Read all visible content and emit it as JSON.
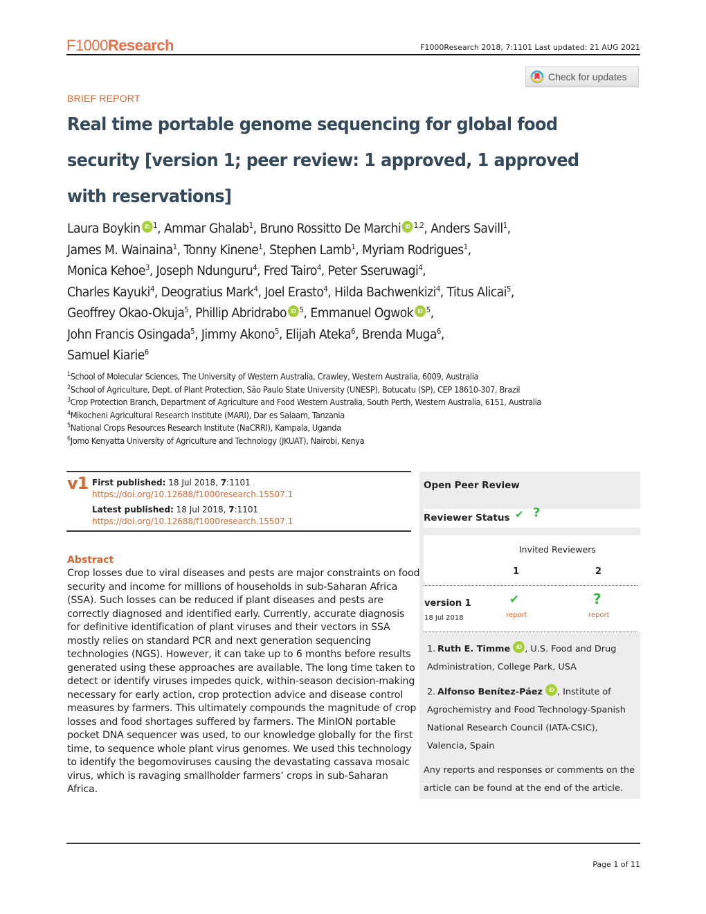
{
  "header": {
    "logo_prefix": "F1000",
    "logo_suffix": "Research",
    "citation": "F1000Research 2018, 7:1101 Last updated: 21 AUG 2021",
    "check_updates_label": "Check for updates"
  },
  "article": {
    "type": "BRIEF REPORT",
    "title_main": "Real time portable genome sequencing for global food security",
    "title_status": "[version 1; peer review: 1 approved, 1 approved with reservations]",
    "authors": [
      {
        "name": "Laura Boykin",
        "affil": "1",
        "orcid": true,
        "sep": ", "
      },
      {
        "name": "Ammar Ghalab",
        "affil": "1",
        "orcid": false,
        "sep": ", "
      },
      {
        "name": "Bruno Rossitto De Marchi",
        "affil": "1,2",
        "orcid": true,
        "sep": ", "
      },
      {
        "name": "Anders Savill",
        "affil": "1",
        "orcid": false,
        "sep": ", "
      },
      {
        "name": "James M. Wainaina",
        "affil": "1",
        "orcid": false,
        "sep": ", "
      },
      {
        "name": "Tonny Kinene",
        "affil": "1",
        "orcid": false,
        "sep": ", "
      },
      {
        "name": "Stephen Lamb",
        "affil": "1",
        "orcid": false,
        "sep": ", "
      },
      {
        "name": "Myriam Rodrigues",
        "affil": "1",
        "orcid": false,
        "sep": ", "
      },
      {
        "name": "Monica Kehoe",
        "affil": "3",
        "orcid": false,
        "sep": ", "
      },
      {
        "name": "Joseph Ndunguru",
        "affil": "4",
        "orcid": false,
        "sep": ", "
      },
      {
        "name": "Fred Tairo",
        "affil": "4",
        "orcid": false,
        "sep": ", "
      },
      {
        "name": "Peter Sseruwagi",
        "affil": "4",
        "orcid": false,
        "sep": ", "
      },
      {
        "name": "Charles Kayuki",
        "affil": "4",
        "orcid": false,
        "sep": ", "
      },
      {
        "name": "Deogratius Mark",
        "affil": "4",
        "orcid": false,
        "sep": ", "
      },
      {
        "name": "Joel Erasto",
        "affil": "4",
        "orcid": false,
        "sep": ", "
      },
      {
        "name": "Hilda Bachwenkizi",
        "affil": "4",
        "orcid": false,
        "sep": ", "
      },
      {
        "name": "Titus Alicai",
        "affil": "5",
        "orcid": false,
        "sep": ", "
      },
      {
        "name": "Geoffrey Okao-Okuja",
        "affil": "5",
        "orcid": false,
        "sep": ", "
      },
      {
        "name": "Phillip Abridrabo",
        "affil": "5",
        "orcid": true,
        "sep": ", "
      },
      {
        "name": "Emmanuel Ogwok",
        "affil": "5",
        "orcid": true,
        "sep": ", "
      },
      {
        "name": "John Francis Osingada",
        "affil": "5",
        "orcid": false,
        "sep": ", "
      },
      {
        "name": "Jimmy Akono",
        "affil": "5",
        "orcid": false,
        "sep": ", "
      },
      {
        "name": "Elijah Ateka",
        "affil": "6",
        "orcid": false,
        "sep": ", "
      },
      {
        "name": "Brenda Muga",
        "affil": "6",
        "orcid": false,
        "sep": ", "
      },
      {
        "name": "Samuel Kiarie",
        "affil": "6",
        "orcid": false,
        "sep": ""
      }
    ],
    "affiliations": [
      {
        "num": "1",
        "text": "School of Molecular Sciences, The University of Western Australia, Crawley, Western Australia, 6009, Australia"
      },
      {
        "num": "2",
        "text": "School of Agriculture, Dept. of Plant Protection, São Paulo State University (UNESP), Botucatu (SP), CEP 18610-307, Brazil"
      },
      {
        "num": "3",
        "text": "Crop Protection Branch, Department of Agriculture and Food Western Australia, South Perth, Western Australia, 6151, Australia"
      },
      {
        "num": "4",
        "text": "Mikocheni Agricultural Research Institute (MARI), Dar es Salaam, Tanzania"
      },
      {
        "num": "5",
        "text": "National Crops Resources Research Institute (NaCRRI), Kampala, Uganda"
      },
      {
        "num": "6",
        "text": "Jomo Kenyatta University of Agriculture and Technology (JKUAT), Nairobi, Kenya"
      }
    ],
    "orcid_label": "iD"
  },
  "version": {
    "label": "v1",
    "first_published_label": "First published:",
    "first_published_date": " 18 Jul 2018, ",
    "first_published_volume": "7",
    "first_published_article": ":1101",
    "first_doi": "https://doi.org/10.12688/f1000research.15507.1",
    "latest_published_label": "Latest published:",
    "latest_published_date": " 18 Jul 2018, ",
    "latest_published_volume": "7",
    "latest_published_article": ":1101",
    "latest_doi": "https://doi.org/10.12688/f1000research.15507.1"
  },
  "abstract": {
    "heading": "Abstract",
    "body": "Crop losses due to viral diseases and pests are major constraints on food security and income for millions of households in sub-Saharan Africa (SSA). Such losses can be reduced if plant diseases and pests are correctly diagnosed and identified early. Currently, accurate diagnosis for definitive identification of plant viruses and their vectors in SSA mostly relies on standard PCR and next generation sequencing technologies (NGS). However, it can take up to 6 months before results generated using these approaches are available. The long time taken to detect or identify viruses impedes quick, within-season decision-making necessary for early action, crop protection advice and disease control measures by farmers. This ultimately compounds the magnitude of crop losses and food shortages suffered by farmers. The MinION portable pocket DNA sequencer was used, to our knowledge globally for the first time, to sequence whole plant virus genomes. We used this technology to identify the begomoviruses causing the devastating cassava mosaic virus, which is ravaging smallholder farmers’ crops in sub-Saharan Africa."
  },
  "peer_review": {
    "title": "Open Peer Review",
    "reviewer_status_label": "Reviewer Status",
    "status_icons": [
      "approved-check",
      "approved-with-reservations-question"
    ],
    "invited_label": "Invited Reviewers",
    "columns": [
      "1",
      "2"
    ],
    "versions": [
      {
        "label": "version 1",
        "date": "18 Jul 2018",
        "statuses": [
          "approved",
          "approved-with-reservations"
        ],
        "report_labels": [
          "report",
          "report"
        ]
      }
    ],
    "status_glyphs": {
      "approved": "✔",
      "reservations": "?"
    },
    "reviewers": [
      {
        "num": "1.",
        "name": "Ruth E. Timme",
        "orcid": true,
        "affiliation": ", U.S. Food and Drug Administration, College Park, USA"
      },
      {
        "num": "2.",
        "name": "Alfonso Benítez-Páez",
        "orcid": true,
        "affiliation": ", Institute of Agrochemistry and Food Technology-Spanish National Research Council (IATA-CSIC), Valencia, Spain"
      }
    ],
    "footer_note": "Any reports and responses or comments on the article can be found at the end of the article."
  },
  "footer": {
    "page_label": "Page 1 of 11"
  },
  "colors": {
    "brand_orange": "#ea6f47",
    "accent_orange": "#d06a35",
    "title_slate": "#34495a",
    "orcid_green": "#a6ce39",
    "status_green": "#3db54a",
    "panel_gray": "#ececec"
  }
}
